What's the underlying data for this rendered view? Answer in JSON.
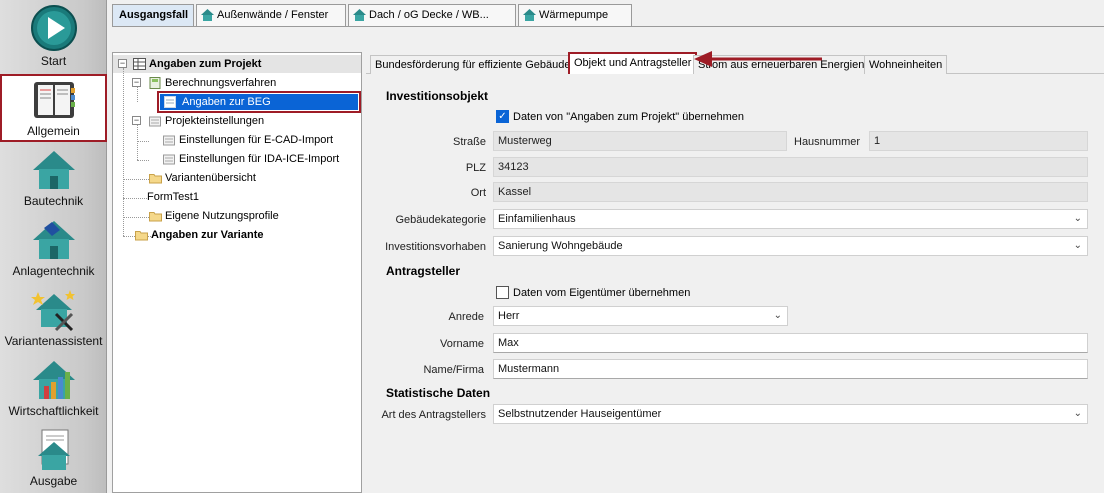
{
  "nav": {
    "start": "Start",
    "allgemein": "Allgemein",
    "bautechnik": "Bautechnik",
    "anlagentechnik": "Anlagentechnik",
    "variantenassistent": "Variantenassistent",
    "wirtschaftlichkeit": "Wirtschaftlichkeit",
    "ausgabe": "Ausgabe"
  },
  "top_tabs": {
    "t0": "Ausgangsfall",
    "t1": "Außenwände / Fenster",
    "t2": "Dach / oG Decke / WB...",
    "t3": "Wärmepumpe"
  },
  "tree": {
    "root": "Angaben zum Projekt",
    "berechnungsverfahren": "Berechnungsverfahren",
    "angaben_beg": "Angaben zur BEG",
    "projekteinstellungen": "Projekteinstellungen",
    "ecad": "Einstellungen für E-CAD-Import",
    "idaice": "Einstellungen für IDA-ICE-Import",
    "variantenuebersicht": "Variantenübersicht",
    "formtest": "FormTest1",
    "nutzungsprofile": "Eigene Nutzungsprofile",
    "variante": "Angaben zur Variante"
  },
  "form_tabs": {
    "t0": "Bundesförderung für effiziente Gebäude",
    "t1": "Objekt und Antragsteller",
    "t2": "Strom aus erneuerbaren Energien",
    "t3": "Wohneinheiten"
  },
  "form": {
    "investitionsobjekt": "Investitionsobjekt",
    "chk_projekt_label": "Daten von \"Angaben zum Projekt\" übernehmen",
    "chk_projekt_checked": true,
    "strasse_label": "Straße",
    "strasse": "Musterweg",
    "hausnummer_label": "Hausnummer",
    "hausnummer": "1",
    "plz_label": "PLZ",
    "plz": "34123",
    "ort_label": "Ort",
    "ort": "Kassel",
    "gebaeudekategorie_label": "Gebäudekategorie",
    "gebaeudekategorie": "Einfamilienhaus",
    "investitionsvorhaben_label": "Investitionsvorhaben",
    "investitionsvorhaben": "Sanierung Wohngebäude",
    "antragsteller": "Antragsteller",
    "chk_eigentuemer_label": "Daten vom Eigentümer übernehmen",
    "chk_eigentuemer_checked": false,
    "anrede_label": "Anrede",
    "anrede": "Herr",
    "vorname_label": "Vorname",
    "vorname": "Max",
    "name_label": "Name/Firma",
    "name": "Mustermann",
    "statistische_daten": "Statistische Daten",
    "art_label": "Art des Antragstellers",
    "art": "Selbstnutzender Hauseigentümer"
  },
  "colors": {
    "highlight_red": "#9e1c26",
    "selection_blue": "#0a64d6"
  }
}
